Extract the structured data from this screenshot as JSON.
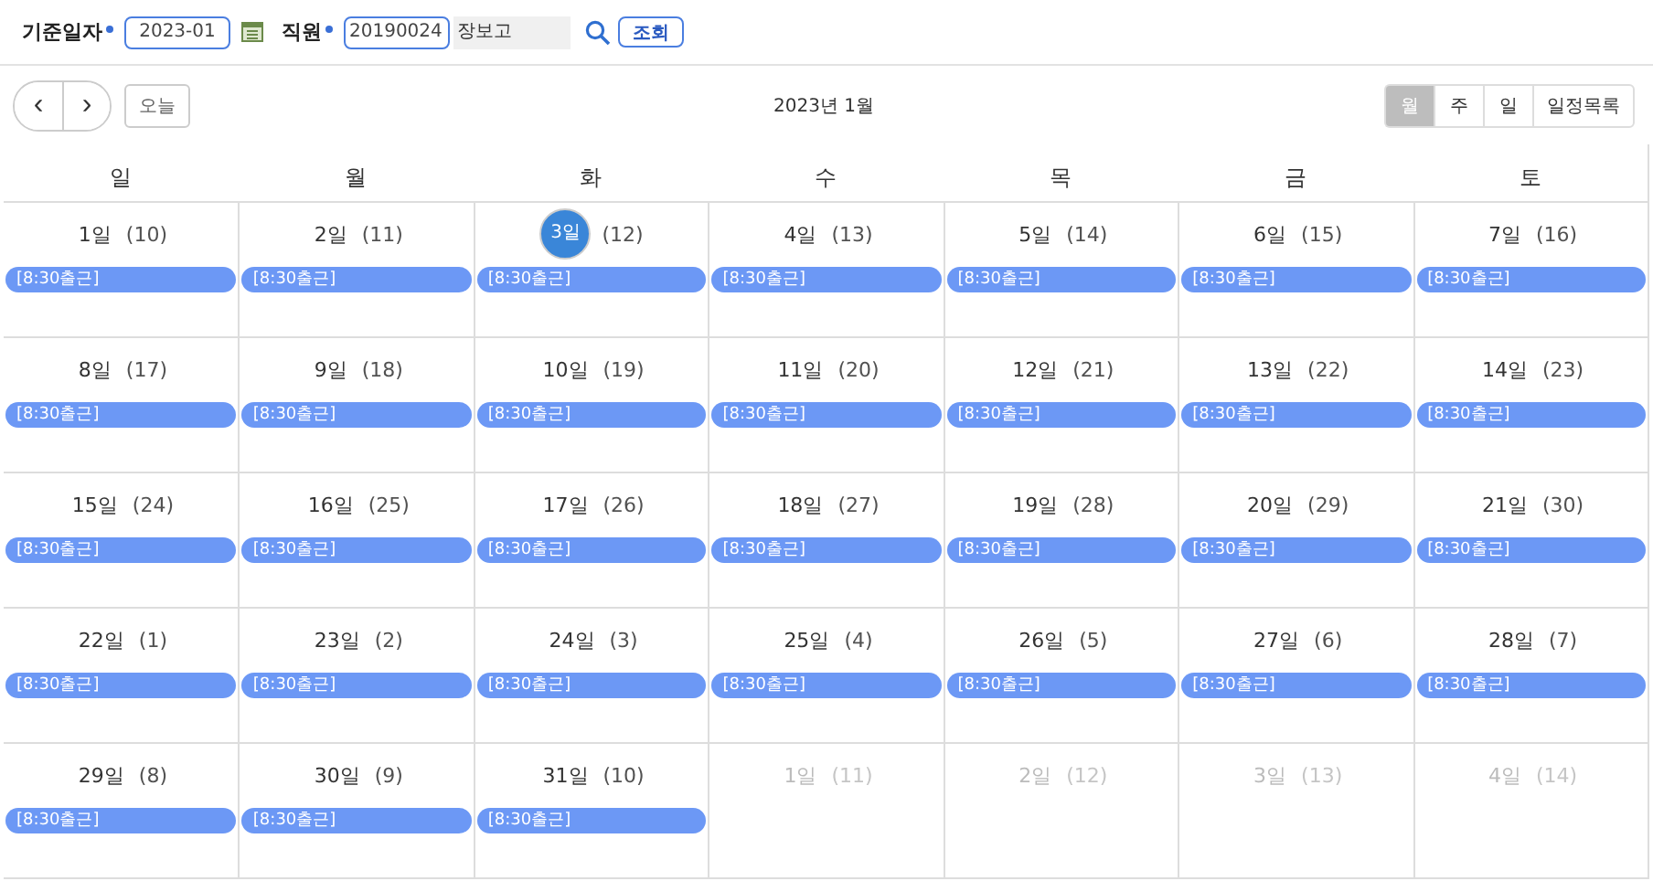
{
  "search": {
    "date_label": "기준일자",
    "date_value": "2023-01",
    "employee_label": "직원",
    "employee_id": "20190024",
    "employee_name": "장보고",
    "submit": "조회"
  },
  "toolbar": {
    "prev": "‹",
    "next": "›",
    "today": "오늘",
    "title": "2023년 1월",
    "views": [
      {
        "label": "월",
        "selected": true
      },
      {
        "label": "주",
        "selected": false
      },
      {
        "label": "일",
        "selected": false
      },
      {
        "label": "일정목록",
        "selected": false
      }
    ]
  },
  "weekdays": [
    "일",
    "월",
    "화",
    "수",
    "목",
    "금",
    "토"
  ],
  "weeks": [
    {
      "days": [
        {
          "day": "1일",
          "lunar": "(10)",
          "other_month": false,
          "today": false,
          "event": "[8:30출근]"
        },
        {
          "day": "2일",
          "lunar": "(11)",
          "other_month": false,
          "today": false,
          "event": "[8:30출근]"
        },
        {
          "day": "3일",
          "lunar": "(12)",
          "other_month": false,
          "today": true,
          "event": "[8:30출근]"
        },
        {
          "day": "4일",
          "lunar": "(13)",
          "other_month": false,
          "today": false,
          "event": "[8:30출근]"
        },
        {
          "day": "5일",
          "lunar": "(14)",
          "other_month": false,
          "today": false,
          "event": "[8:30출근]"
        },
        {
          "day": "6일",
          "lunar": "(15)",
          "other_month": false,
          "today": false,
          "event": "[8:30출근]"
        },
        {
          "day": "7일",
          "lunar": "(16)",
          "other_month": false,
          "today": false,
          "event": "[8:30출근]"
        }
      ]
    },
    {
      "days": [
        {
          "day": "8일",
          "lunar": "(17)",
          "other_month": false,
          "today": false,
          "event": "[8:30출근]"
        },
        {
          "day": "9일",
          "lunar": "(18)",
          "other_month": false,
          "today": false,
          "event": "[8:30출근]"
        },
        {
          "day": "10일",
          "lunar": "(19)",
          "other_month": false,
          "today": false,
          "event": "[8:30출근]"
        },
        {
          "day": "11일",
          "lunar": "(20)",
          "other_month": false,
          "today": false,
          "event": "[8:30출근]"
        },
        {
          "day": "12일",
          "lunar": "(21)",
          "other_month": false,
          "today": false,
          "event": "[8:30출근]"
        },
        {
          "day": "13일",
          "lunar": "(22)",
          "other_month": false,
          "today": false,
          "event": "[8:30출근]"
        },
        {
          "day": "14일",
          "lunar": "(23)",
          "other_month": false,
          "today": false,
          "event": "[8:30출근]"
        }
      ]
    },
    {
      "days": [
        {
          "day": "15일",
          "lunar": "(24)",
          "other_month": false,
          "today": false,
          "event": "[8:30출근]"
        },
        {
          "day": "16일",
          "lunar": "(25)",
          "other_month": false,
          "today": false,
          "event": "[8:30출근]"
        },
        {
          "day": "17일",
          "lunar": "(26)",
          "other_month": false,
          "today": false,
          "event": "[8:30출근]"
        },
        {
          "day": "18일",
          "lunar": "(27)",
          "other_month": false,
          "today": false,
          "event": "[8:30출근]"
        },
        {
          "day": "19일",
          "lunar": "(28)",
          "other_month": false,
          "today": false,
          "event": "[8:30출근]"
        },
        {
          "day": "20일",
          "lunar": "(29)",
          "other_month": false,
          "today": false,
          "event": "[8:30출근]"
        },
        {
          "day": "21일",
          "lunar": "(30)",
          "other_month": false,
          "today": false,
          "event": "[8:30출근]"
        }
      ]
    },
    {
      "days": [
        {
          "day": "22일",
          "lunar": "(1)",
          "other_month": false,
          "today": false,
          "event": "[8:30출근]"
        },
        {
          "day": "23일",
          "lunar": "(2)",
          "other_month": false,
          "today": false,
          "event": "[8:30출근]"
        },
        {
          "day": "24일",
          "lunar": "(3)",
          "other_month": false,
          "today": false,
          "event": "[8:30출근]"
        },
        {
          "day": "25일",
          "lunar": "(4)",
          "other_month": false,
          "today": false,
          "event": "[8:30출근]"
        },
        {
          "day": "26일",
          "lunar": "(5)",
          "other_month": false,
          "today": false,
          "event": "[8:30출근]"
        },
        {
          "day": "27일",
          "lunar": "(6)",
          "other_month": false,
          "today": false,
          "event": "[8:30출근]"
        },
        {
          "day": "28일",
          "lunar": "(7)",
          "other_month": false,
          "today": false,
          "event": "[8:30출근]"
        }
      ]
    },
    {
      "days": [
        {
          "day": "29일",
          "lunar": "(8)",
          "other_month": false,
          "today": false,
          "event": "[8:30출근]"
        },
        {
          "day": "30일",
          "lunar": "(9)",
          "other_month": false,
          "today": false,
          "event": "[8:30출근]"
        },
        {
          "day": "31일",
          "lunar": "(10)",
          "other_month": false,
          "today": false,
          "event": "[8:30출근]"
        },
        {
          "day": "1일",
          "lunar": "(11)",
          "other_month": true,
          "today": false
        },
        {
          "day": "2일",
          "lunar": "(12)",
          "other_month": true,
          "today": false
        },
        {
          "day": "3일",
          "lunar": "(13)",
          "other_month": true,
          "today": false
        },
        {
          "day": "4일",
          "lunar": "(14)",
          "other_month": true,
          "today": false
        }
      ]
    }
  ]
}
